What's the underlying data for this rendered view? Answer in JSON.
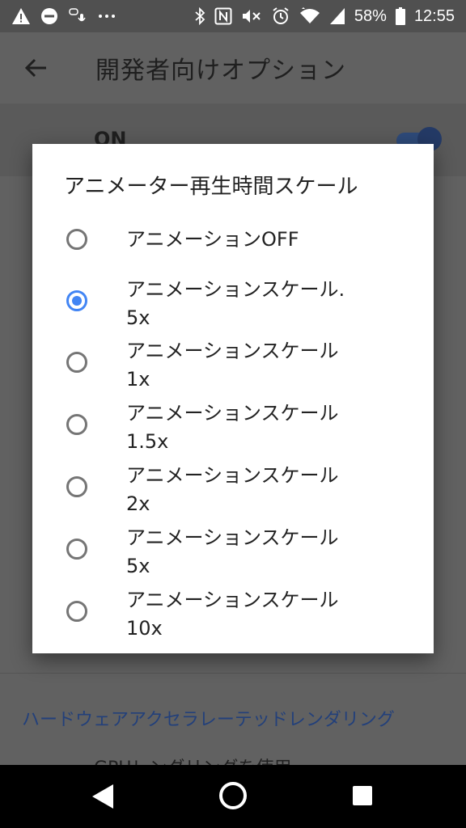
{
  "status_bar": {
    "battery_percent": "58%",
    "time": "12:55",
    "left_icons": [
      "warning-icon",
      "do-not-disturb-icon",
      "voice-input-icon",
      "more-notifications-icon"
    ],
    "right_icons": [
      "bluetooth-icon",
      "nfc-icon",
      "mute-icon",
      "alarm-icon",
      "wifi-icon",
      "cell-signal-icon",
      "battery-icon"
    ]
  },
  "app_bar": {
    "title": "開発者向けオプション"
  },
  "background": {
    "master_toggle_label": "ON",
    "section_header": "ハードウェアアクセラレーテッドレンダリング",
    "partial_item": "GPUレンダリングを使用"
  },
  "dialog": {
    "title": "アニメーター再生時間スケール",
    "options": [
      {
        "label": "アニメーションOFF",
        "selected": false
      },
      {
        "label": "アニメーションスケール.\n5x",
        "selected": true
      },
      {
        "label": "アニメーションスケール\n1x",
        "selected": false
      },
      {
        "label": "アニメーションスケール\n1.5x",
        "selected": false
      },
      {
        "label": "アニメーションスケール\n2x",
        "selected": false
      },
      {
        "label": "アニメーションスケール\n5x",
        "selected": false
      },
      {
        "label": "アニメーションスケール\n10x",
        "selected": false
      }
    ]
  },
  "colors": {
    "accent": "#4285f4",
    "scrim": "#616161",
    "dialog_bg": "#ffffff"
  }
}
